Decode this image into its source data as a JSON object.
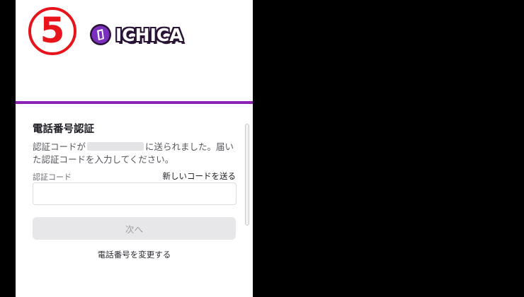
{
  "step": {
    "number": "5"
  },
  "logo": {
    "text": "ICHICA"
  },
  "colors": {
    "accent": "#8b22b8",
    "step_red": "#e8141b",
    "logo_purple": "#7b2fbe"
  },
  "verification": {
    "title": "電話番号認証",
    "desc_prefix": "認証コードが",
    "desc_suffix": "に送られました。届いた認証コードを入力してください。",
    "code_label": "認証コード",
    "resend_link": "新しいコードを送る",
    "code_value": "",
    "next_button": "次へ",
    "change_phone_link": "電話番号を変更する"
  }
}
